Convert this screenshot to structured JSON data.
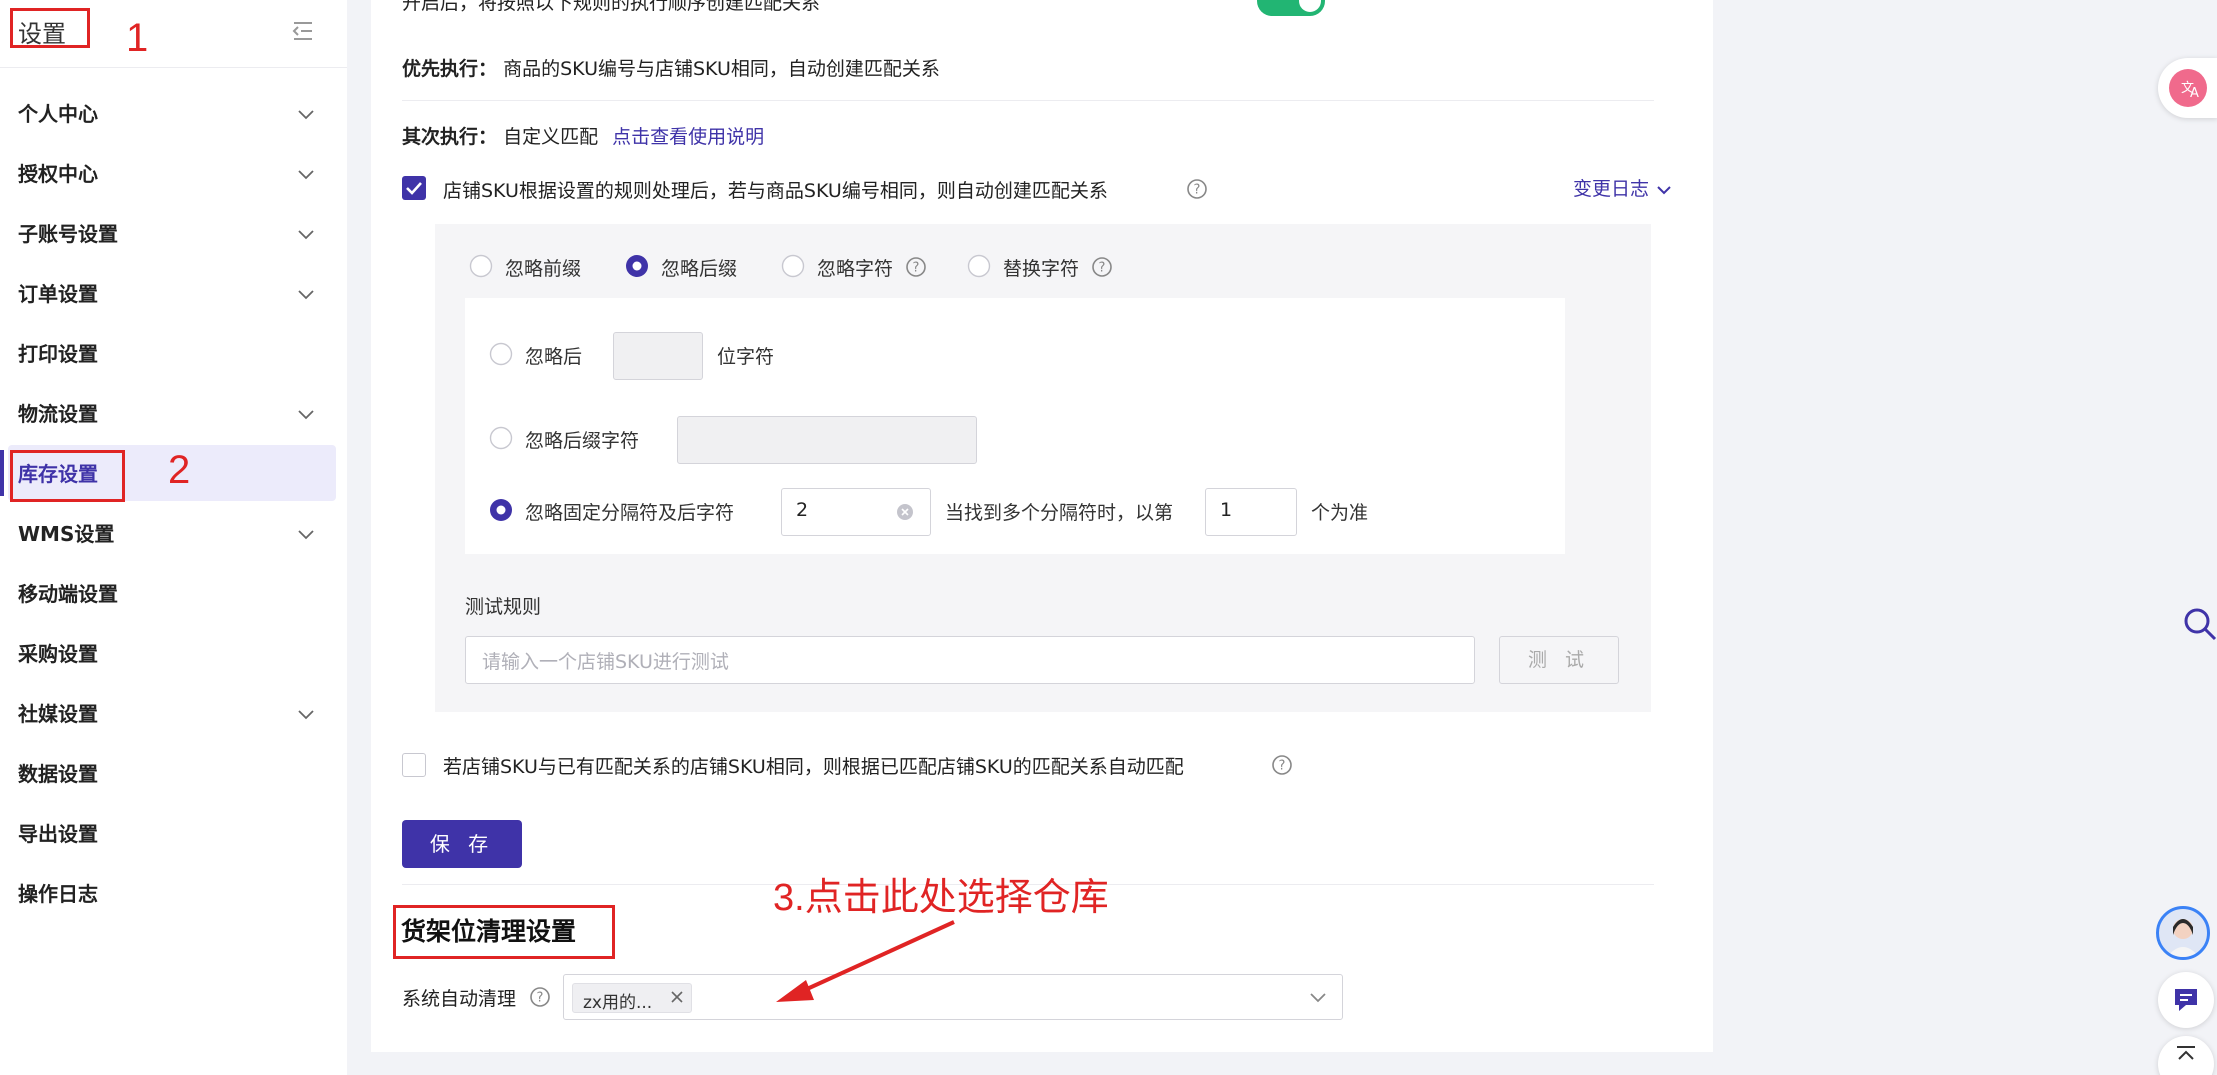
{
  "sidebar": {
    "title": "设置",
    "items": [
      {
        "label": "个人中心",
        "has_chevron": true
      },
      {
        "label": "授权中心",
        "has_chevron": true
      },
      {
        "label": "子账号设置",
        "has_chevron": true
      },
      {
        "label": "订单设置",
        "has_chevron": true
      },
      {
        "label": "打印设置",
        "has_chevron": false
      },
      {
        "label": "物流设置",
        "has_chevron": true
      },
      {
        "label": "库存设置",
        "has_chevron": false,
        "active": true
      },
      {
        "label": "WMS设置",
        "has_chevron": true
      },
      {
        "label": "移动端设置",
        "has_chevron": false
      },
      {
        "label": "采购设置",
        "has_chevron": false
      },
      {
        "label": "社媒设置",
        "has_chevron": true
      },
      {
        "label": "数据设置",
        "has_chevron": false
      },
      {
        "label": "导出设置",
        "has_chevron": false
      },
      {
        "label": "操作日志",
        "has_chevron": false
      }
    ]
  },
  "main": {
    "top_clipped_text": "开启后，将按照以下规则的执行顺序创建匹配关系",
    "priority_label": "优先执行：",
    "priority_text": "商品的SKU编号与店铺SKU相同，自动创建匹配关系",
    "secondary_label": "其次执行：",
    "secondary_text": "自定义匹配",
    "secondary_link": "点击查看使用说明",
    "rule_checkbox_label": "店铺SKU根据设置的规则处理后，若与商品SKU编号相同，则自动创建匹配关系",
    "changelog_link": "变更日志",
    "rule_tabs": [
      {
        "label": "忽略前缀",
        "selected": false,
        "help": false
      },
      {
        "label": "忽略后缀",
        "selected": true,
        "help": false
      },
      {
        "label": "忽略字符",
        "selected": false,
        "help": true
      },
      {
        "label": "替换字符",
        "selected": false,
        "help": true
      }
    ],
    "suffix_options": {
      "opt1_prefix": "忽略后",
      "opt1_suffix": "位字符",
      "opt2_label": "忽略后缀字符",
      "opt3_label": "忽略固定分隔符及后字符",
      "separator_value": "2",
      "multi_text": "当找到多个分隔符时，以第",
      "index_value": "1",
      "index_suffix": "个为准"
    },
    "test": {
      "label": "测试规则",
      "placeholder": "请输入一个店铺SKU进行测试",
      "button": "测 试"
    },
    "auto_match_label": "若店铺SKU与已有匹配关系的店铺SKU相同，则根据已匹配店铺SKU的匹配关系自动匹配",
    "save_button": "保 存",
    "shelf_section_title": "货架位清理设置",
    "auto_clean_label": "系统自动清理",
    "warehouse_tag": "zx用的..."
  },
  "annotations": {
    "num1": "1",
    "num2": "2",
    "note3": "3.点击此处选择仓库"
  },
  "colors": {
    "accent": "#3f33a8",
    "toggle_on": "#22b573",
    "annotation": "#e02424"
  }
}
